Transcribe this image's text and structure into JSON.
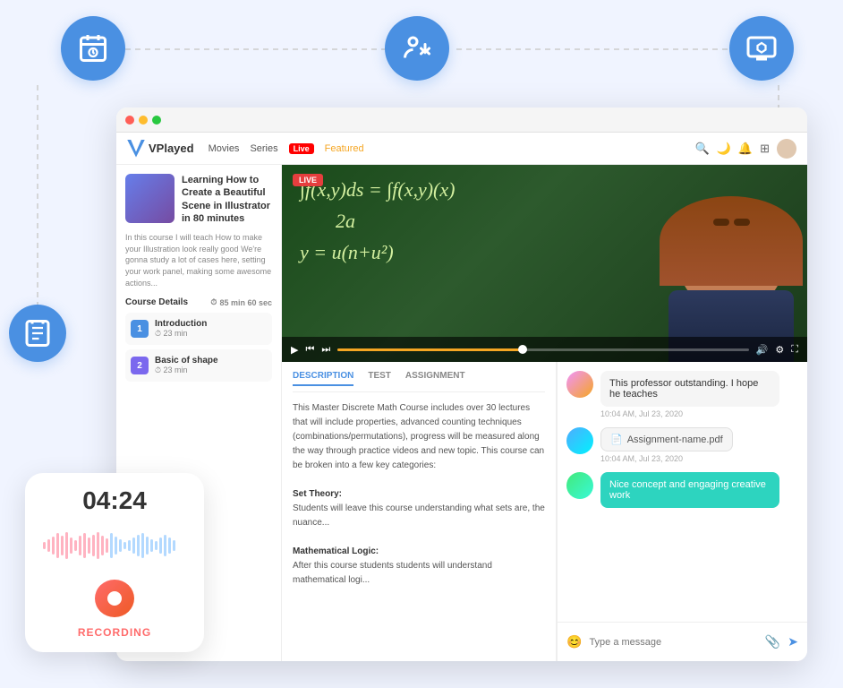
{
  "app": {
    "title": "VPlayed",
    "browser_dots": [
      "red",
      "yellow",
      "green"
    ]
  },
  "nav": {
    "logo": "VPlayed",
    "links": [
      "Movies",
      "Series"
    ],
    "live_label": "Live",
    "featured_label": "Featured",
    "icons": [
      "search",
      "moon",
      "bell",
      "grid",
      "user"
    ]
  },
  "sidebar": {
    "course_title": "Learning How to Create a Beautiful Scene in Illustrator in 80 minutes",
    "course_desc": "In this course I will teach How to make your Illustration look really good We're gonna study a lot of cases here, setting your work panel, making some awesome actions...",
    "details_label": "Course Details",
    "time": "85 min 60 sec",
    "lessons": [
      {
        "num": "1",
        "name": "Introduction",
        "duration": "23 min"
      },
      {
        "num": "2",
        "name": "Basic of shape",
        "duration": "23 min"
      }
    ]
  },
  "video": {
    "live_badge": "LIVE",
    "math_line1": "∫f(x,y)ds = ∫f(x,y)(x)",
    "math_line2": "2a",
    "math_line3": "y = u(n+u²)"
  },
  "description": {
    "tabs": [
      "DESCRIPTION",
      "TEST",
      "ASSIGNMENT"
    ],
    "active_tab": "DESCRIPTION",
    "text": "This Master Discrete Math Course includes over 30 lectures that will include properties, advanced counting techniques (combinations/permutations), progress will be measured along the way through practice videos and new topic. This course can be broken into a few key categories:",
    "section1_title": "Set Theory:",
    "section1_text": "Students will leave this course understanding what sets are, the nuance...",
    "section2_title": "Mathematical Logic:",
    "section2_text": "After this course students students will understand mathematical logi..."
  },
  "chat": {
    "messages": [
      {
        "id": 1,
        "text": "This professor outstanding. I hope he teaches",
        "time": "10:04 AM, Jul 23, 2020",
        "type": "text"
      },
      {
        "id": 2,
        "text": "Assignment-name.pdf",
        "time": "10:04 AM, Jul 23, 2020",
        "type": "file"
      },
      {
        "id": 3,
        "text": "Nice concept and engaging creative work",
        "time": "",
        "type": "teal"
      }
    ],
    "input_placeholder": "Type a message"
  },
  "recording": {
    "time": "04:24",
    "label": "RECORDING"
  },
  "icons": {
    "calendar": "📅",
    "swap": "🔄",
    "screen": "🖥",
    "notepad": "📋"
  }
}
